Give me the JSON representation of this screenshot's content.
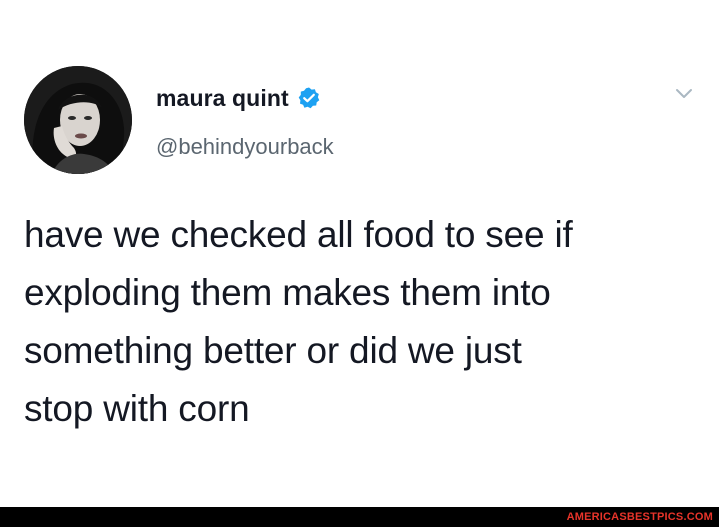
{
  "tweet": {
    "display_name": "maura quint",
    "verified": true,
    "handle": "@behindyourback",
    "text_lines": [
      "have we checked all food to see if",
      "exploding them makes them into",
      "something better or did we just",
      "stop with corn"
    ],
    "menu_icon": "chevron-down-icon",
    "verified_icon": "verified-badge-icon"
  },
  "watermark": {
    "text": "AMERICASBESTPICS.COM"
  },
  "colors": {
    "background": "#ffffff",
    "text": "#141823",
    "handle": "#5b6670",
    "verified_badge": "#1da1f2",
    "chevron": "#aab8c2",
    "watermark_bar": "#000000",
    "watermark_text": "#e8342a"
  }
}
